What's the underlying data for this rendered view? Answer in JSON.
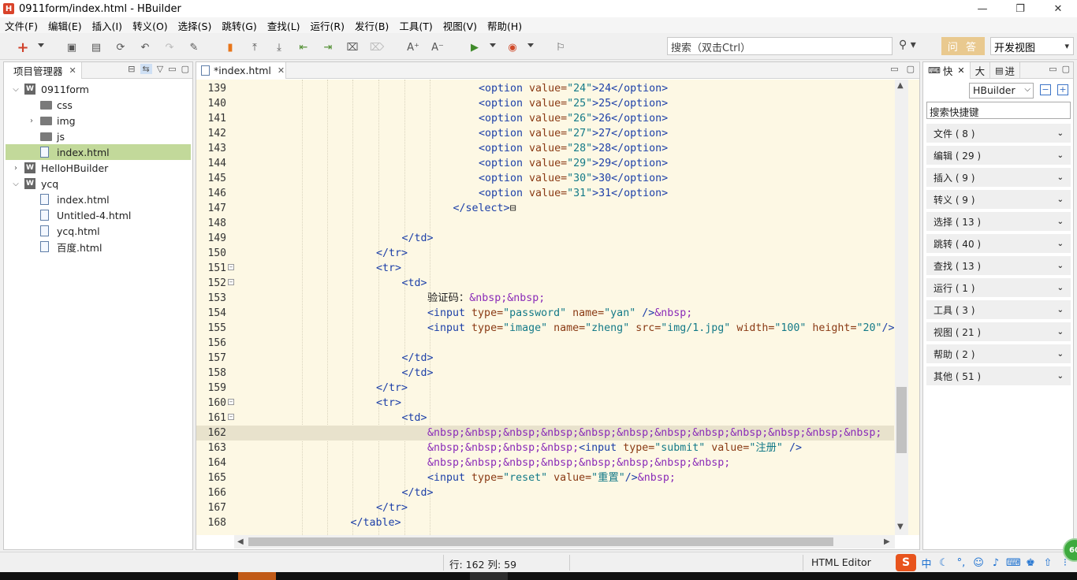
{
  "window": {
    "app_logo": "H",
    "title": "0911form/index.html  -  HBuilder",
    "controls": [
      "—",
      "❐",
      "✕"
    ]
  },
  "menu": [
    "文件(F)",
    "编辑(E)",
    "插入(I)",
    "转义(O)",
    "选择(S)",
    "跳转(G)",
    "查找(L)",
    "运行(R)",
    "发行(B)",
    "工具(T)",
    "视图(V)",
    "帮助(H)"
  ],
  "toolbar": {
    "search_placeholder": "搜索（双击Ctrl）",
    "qa_label": "问 答",
    "view_label": "开发视图"
  },
  "project_panel": {
    "tab_label": "项目管理器",
    "tree": [
      {
        "label": "0911form",
        "kind": "project",
        "depth": 0,
        "twisty": "⌵",
        "selected": false
      },
      {
        "label": "css",
        "kind": "folder",
        "depth": 1,
        "twisty": "",
        "selected": false
      },
      {
        "label": "img",
        "kind": "folder",
        "depth": 1,
        "twisty": "›",
        "selected": false
      },
      {
        "label": "js",
        "kind": "folder",
        "depth": 1,
        "twisty": "",
        "selected": false
      },
      {
        "label": "index.html",
        "kind": "file",
        "depth": 1,
        "twisty": "",
        "selected": true
      },
      {
        "label": "HelloHBuilder",
        "kind": "project",
        "depth": 0,
        "twisty": "›",
        "selected": false
      },
      {
        "label": "ycq",
        "kind": "project",
        "depth": 0,
        "twisty": "⌵",
        "selected": false
      },
      {
        "label": "index.html",
        "kind": "file",
        "depth": 1,
        "twisty": "",
        "selected": false
      },
      {
        "label": "Untitled-4.html",
        "kind": "file",
        "depth": 1,
        "twisty": "",
        "selected": false
      },
      {
        "label": "ycq.html",
        "kind": "file",
        "depth": 1,
        "twisty": "",
        "selected": false
      },
      {
        "label": "百度.html",
        "kind": "file",
        "depth": 1,
        "twisty": "",
        "selected": false
      }
    ]
  },
  "editor": {
    "tab_label": "*index.html",
    "current_line": 162,
    "lines": [
      {
        "n": 139,
        "indent": 8,
        "fold": false,
        "tokens": [
          [
            "tag",
            "<option "
          ],
          [
            "attr",
            "value="
          ],
          [
            "val",
            "\"24\""
          ],
          [
            "tag",
            ">24</option>"
          ]
        ]
      },
      {
        "n": 140,
        "indent": 8,
        "fold": false,
        "tokens": [
          [
            "tag",
            "<option "
          ],
          [
            "attr",
            "value="
          ],
          [
            "val",
            "\"25\""
          ],
          [
            "tag",
            ">25</option>"
          ]
        ]
      },
      {
        "n": 141,
        "indent": 8,
        "fold": false,
        "tokens": [
          [
            "tag",
            "<option "
          ],
          [
            "attr",
            "value="
          ],
          [
            "val",
            "\"26\""
          ],
          [
            "tag",
            ">26</option>"
          ]
        ]
      },
      {
        "n": 142,
        "indent": 8,
        "fold": false,
        "tokens": [
          [
            "tag",
            "<option "
          ],
          [
            "attr",
            "value="
          ],
          [
            "val",
            "\"27\""
          ],
          [
            "tag",
            ">27</option>"
          ]
        ]
      },
      {
        "n": 143,
        "indent": 8,
        "fold": false,
        "tokens": [
          [
            "tag",
            "<option "
          ],
          [
            "attr",
            "value="
          ],
          [
            "val",
            "\"28\""
          ],
          [
            "tag",
            ">28</option>"
          ]
        ]
      },
      {
        "n": 144,
        "indent": 8,
        "fold": false,
        "tokens": [
          [
            "tag",
            "<option "
          ],
          [
            "attr",
            "value="
          ],
          [
            "val",
            "\"29\""
          ],
          [
            "tag",
            ">29</option>"
          ]
        ]
      },
      {
        "n": 145,
        "indent": 8,
        "fold": false,
        "tokens": [
          [
            "tag",
            "<option "
          ],
          [
            "attr",
            "value="
          ],
          [
            "val",
            "\"30\""
          ],
          [
            "tag",
            ">30</option>"
          ]
        ]
      },
      {
        "n": 146,
        "indent": 8,
        "fold": false,
        "tokens": [
          [
            "tag",
            "<option "
          ],
          [
            "attr",
            "value="
          ],
          [
            "val",
            "\"31\""
          ],
          [
            "tag",
            ">31</option>"
          ]
        ]
      },
      {
        "n": 147,
        "indent": 7,
        "fold": false,
        "tokens": [
          [
            "tag",
            "</select>"
          ],
          [
            "plain",
            "⊟"
          ]
        ]
      },
      {
        "n": 148,
        "indent": 0,
        "fold": false,
        "tokens": []
      },
      {
        "n": 149,
        "indent": 5,
        "fold": false,
        "tokens": [
          [
            "tag",
            "</td>"
          ]
        ]
      },
      {
        "n": 150,
        "indent": 4,
        "fold": false,
        "tokens": [
          [
            "tag",
            "</tr>"
          ]
        ]
      },
      {
        "n": 151,
        "indent": 4,
        "fold": true,
        "tokens": [
          [
            "tag",
            "<tr>"
          ]
        ]
      },
      {
        "n": 152,
        "indent": 5,
        "fold": true,
        "tokens": [
          [
            "tag",
            "<td>"
          ]
        ]
      },
      {
        "n": 153,
        "indent": 6,
        "fold": false,
        "tokens": [
          [
            "plain",
            "验证码："
          ],
          [
            "ent",
            "&nbsp;&nbsp;"
          ]
        ]
      },
      {
        "n": 154,
        "indent": 6,
        "fold": false,
        "tokens": [
          [
            "tag",
            "<input "
          ],
          [
            "attr",
            "type="
          ],
          [
            "val",
            "\"password\" "
          ],
          [
            "attr",
            "name="
          ],
          [
            "val",
            "\"yan\" "
          ],
          [
            "tag",
            "/>"
          ],
          [
            "ent",
            "&nbsp;"
          ]
        ]
      },
      {
        "n": 155,
        "indent": 6,
        "fold": false,
        "tokens": [
          [
            "tag",
            "<input "
          ],
          [
            "attr",
            "type="
          ],
          [
            "val",
            "\"image\" "
          ],
          [
            "attr",
            "name="
          ],
          [
            "val",
            "\"zheng\" "
          ],
          [
            "attr",
            "src="
          ],
          [
            "val",
            "\"img/1.jpg\" "
          ],
          [
            "attr",
            "width="
          ],
          [
            "val",
            "\"100\" "
          ],
          [
            "attr",
            "height="
          ],
          [
            "val",
            "\"20\""
          ],
          [
            "tag",
            "/>"
          ]
        ]
      },
      {
        "n": 156,
        "indent": 0,
        "fold": false,
        "tokens": []
      },
      {
        "n": 157,
        "indent": 5,
        "fold": false,
        "tokens": [
          [
            "tag",
            "</td>"
          ]
        ]
      },
      {
        "n": 158,
        "indent": 5,
        "fold": false,
        "tokens": [
          [
            "tag",
            "</td>"
          ]
        ]
      },
      {
        "n": 159,
        "indent": 4,
        "fold": false,
        "tokens": [
          [
            "tag",
            "</tr>"
          ]
        ]
      },
      {
        "n": 160,
        "indent": 4,
        "fold": true,
        "tokens": [
          [
            "tag",
            "<tr>"
          ]
        ]
      },
      {
        "n": 161,
        "indent": 5,
        "fold": true,
        "tokens": [
          [
            "tag",
            "<td>"
          ]
        ]
      },
      {
        "n": 162,
        "indent": 6,
        "fold": false,
        "tokens": [
          [
            "ent",
            "&nbsp;&nbsp;&nbsp;&nbsp;&nbsp;&nbsp;&nbsp;&nbsp;&nbsp;&nbsp;&nbsp;&nbsp;"
          ]
        ]
      },
      {
        "n": 163,
        "indent": 6,
        "fold": false,
        "tokens": [
          [
            "ent",
            "&nbsp;&nbsp;&nbsp;&nbsp;"
          ],
          [
            "tag",
            "<input "
          ],
          [
            "attr",
            "type="
          ],
          [
            "val",
            "\"submit\" "
          ],
          [
            "attr",
            "value="
          ],
          [
            "val",
            "\"注册\" "
          ],
          [
            "tag",
            "/>"
          ]
        ]
      },
      {
        "n": 164,
        "indent": 6,
        "fold": false,
        "tokens": [
          [
            "ent",
            "&nbsp;&nbsp;&nbsp;&nbsp;&nbsp;&nbsp;&nbsp;&nbsp;"
          ]
        ]
      },
      {
        "n": 165,
        "indent": 6,
        "fold": false,
        "tokens": [
          [
            "tag",
            "<input "
          ],
          [
            "attr",
            "type="
          ],
          [
            "val",
            "\"reset\" "
          ],
          [
            "attr",
            "value="
          ],
          [
            "val",
            "\"重置\""
          ],
          [
            "tag",
            "/>"
          ],
          [
            "ent",
            "&nbsp;"
          ]
        ]
      },
      {
        "n": 166,
        "indent": 5,
        "fold": false,
        "tokens": [
          [
            "tag",
            "</td>"
          ]
        ]
      },
      {
        "n": 167,
        "indent": 4,
        "fold": false,
        "tokens": [
          [
            "tag",
            "</tr>"
          ]
        ]
      },
      {
        "n": 168,
        "indent": 3,
        "fold": false,
        "tokens": [
          [
            "tag",
            "</table>"
          ]
        ]
      }
    ]
  },
  "shortcut_panel": {
    "tabs": [
      "快",
      "大",
      "进"
    ],
    "selector": "HBuilder",
    "search_placeholder": "搜索快捷键",
    "categories": [
      "文件 ( 8 )",
      "编辑 ( 29 )",
      "插入 ( 9 )",
      "转义 ( 9 )",
      "选择 ( 13 )",
      "跳转 ( 40 )",
      "查找 ( 13 )",
      "运行 ( 1 )",
      "工具 ( 3 )",
      "视图 ( 21 )",
      "帮助 ( 2 )",
      "其他 ( 51 )"
    ]
  },
  "status": {
    "position": "行: 162 列: 59",
    "editor_type": "HTML Editor",
    "ime_logo": "S",
    "ime_mode": "中",
    "badge": "60"
  },
  "colors": {
    "editor_bg": "#fdf8e4",
    "current_line": "#e8e2cc",
    "selected_tree": "#c2d99a",
    "tag": "#1c3fa8",
    "attr": "#8a3a14",
    "value": "#147a88",
    "entity": "#8a2bb8",
    "qa_button": "#e9c98f"
  }
}
